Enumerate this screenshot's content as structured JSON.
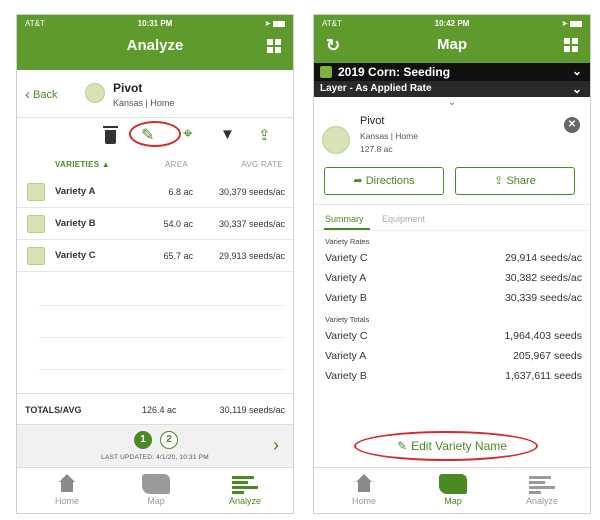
{
  "left": {
    "status": {
      "carrier": "AT&T",
      "time": "10:31 PM"
    },
    "nav": {
      "title": "Analyze"
    },
    "header": {
      "back_label": "Back",
      "field_name": "Pivot",
      "field_sub": "Kansas | Home"
    },
    "columns": {
      "varieties": "VARIETIES ▲",
      "area": "AREA",
      "avg_rate": "AVG RATE"
    },
    "rows": [
      {
        "name": "Variety A",
        "area": "6.8 ac",
        "rate": "30,379 seeds/ac"
      },
      {
        "name": "Variety B",
        "area": "54.0 ac",
        "rate": "30,337 seeds/ac"
      },
      {
        "name": "Variety C",
        "area": "65.7 ac",
        "rate": "29,913 seeds/ac"
      }
    ],
    "totals": {
      "label": "TOTALS/AVG",
      "area": "126.4 ac",
      "rate": "30,119 seeds/ac"
    },
    "pager": {
      "page1": "1",
      "page2": "2",
      "updated": "LAST UPDATED: 4/1/20, 10:31 PM"
    },
    "tabs": {
      "home": "Home",
      "map": "Map",
      "analyze": "Analyze"
    }
  },
  "right": {
    "status": {
      "carrier": "AT&T",
      "time": "10:42 PM"
    },
    "nav": {
      "title": "Map"
    },
    "layer1": "2019 Corn: Seeding",
    "layer2": "Layer - As Applied Rate",
    "card": {
      "name": "Pivot",
      "sub": "Kansas | Home",
      "size": "127.8 ac"
    },
    "buttons": {
      "directions": "Directions",
      "share": "Share"
    },
    "segments": {
      "summary": "Summary",
      "equipment": "Equipment"
    },
    "rates": {
      "title": "Variety Rates",
      "items": [
        {
          "label": "Variety C",
          "value": "29,914 seeds/ac"
        },
        {
          "label": "Variety A",
          "value": "30,382 seeds/ac"
        },
        {
          "label": "Variety B",
          "value": "30,339 seeds/ac"
        }
      ]
    },
    "totals": {
      "title": "Variety Totals",
      "items": [
        {
          "label": "Variety C",
          "value": "1,964,403 seeds"
        },
        {
          "label": "Variety A",
          "value": "205,967 seeds"
        },
        {
          "label": "Variety B",
          "value": "1,637,611 seeds"
        }
      ]
    },
    "edit_label": "Edit Variety Name",
    "tabs": {
      "home": "Home",
      "map": "Map",
      "analyze": "Analyze"
    }
  },
  "colors": {
    "brand_green": "#5e9a2c",
    "accent_green": "#4a8a23",
    "highlight_red": "#d32b2b",
    "swatch": "#d5e3b5"
  }
}
